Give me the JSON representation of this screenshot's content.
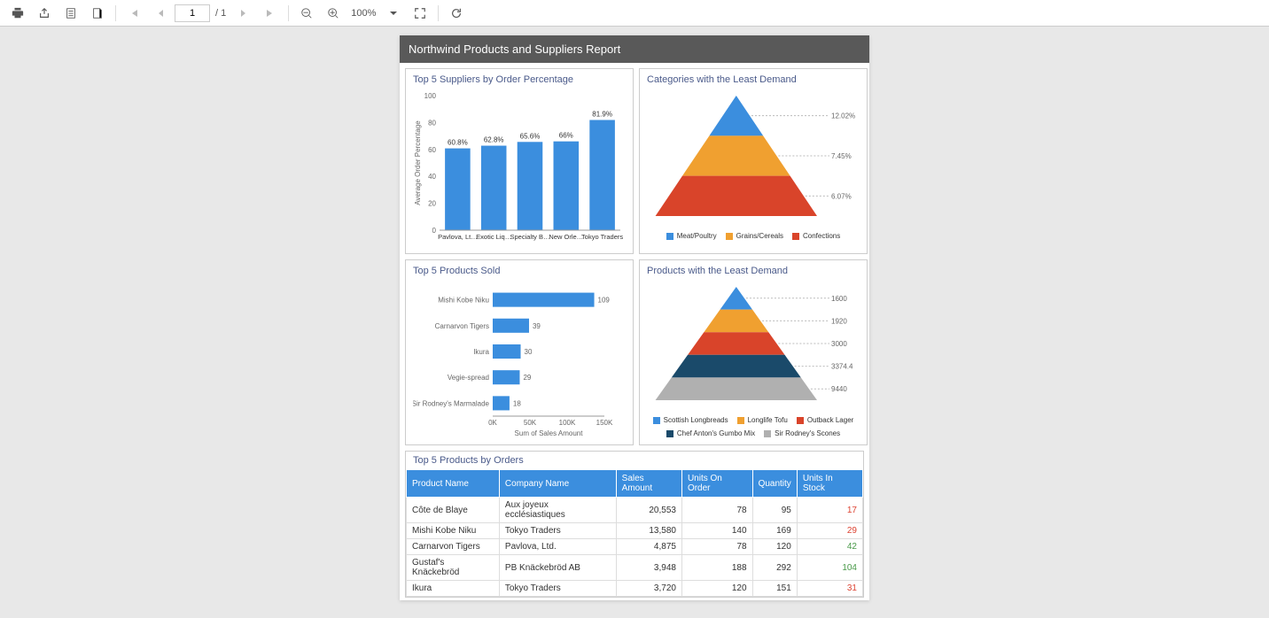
{
  "toolbar": {
    "page_current": "1",
    "page_total": "/ 1",
    "zoom": "100%"
  },
  "report": {
    "title": "Northwind Products and Suppliers Report"
  },
  "panels": {
    "suppliers": "Top 5 Suppliers by Order Percentage",
    "categories_low": "Categories with the Least Demand",
    "products_sold": "Top 5 Products Sold",
    "products_low": "Products with the Least Demand",
    "top_orders": "Top 5 Products by Orders"
  },
  "table": {
    "headers": [
      "Product Name",
      "Company Name",
      "Sales Amount",
      "Units On Order",
      "Quantity",
      "Units In Stock"
    ],
    "rows": [
      {
        "product": "Côte de Blaye",
        "company": "Aux joyeux ecclésiastiques",
        "sales": "20,553",
        "on_order": "78",
        "qty": "95",
        "stock": "17",
        "stock_class": "red"
      },
      {
        "product": "Mishi Kobe Niku",
        "company": "Tokyo Traders",
        "sales": "13,580",
        "on_order": "140",
        "qty": "169",
        "stock": "29",
        "stock_class": "red"
      },
      {
        "product": "Carnarvon Tigers",
        "company": "Pavlova, Ltd.",
        "sales": "4,875",
        "on_order": "78",
        "qty": "120",
        "stock": "42",
        "stock_class": "green"
      },
      {
        "product": "Gustaf's Knäckebröd",
        "company": "PB Knäckebröd AB",
        "sales": "3,948",
        "on_order": "188",
        "qty": "292",
        "stock": "104",
        "stock_class": "green"
      },
      {
        "product": "Ikura",
        "company": "Tokyo Traders",
        "sales": "3,720",
        "on_order": "120",
        "qty": "151",
        "stock": "31",
        "stock_class": "red"
      }
    ]
  },
  "chart_data": [
    {
      "id": "suppliers",
      "type": "bar",
      "orientation": "vertical",
      "title": "Top 5 Suppliers by Order Percentage",
      "ylabel": "Average Order Percentage",
      "ylim": [
        0,
        100
      ],
      "categories": [
        "Pavlova, Lt…",
        "Exotic Liq…",
        "Specialty B…",
        "New Orle…",
        "Tokyo Traders"
      ],
      "values": [
        60.8,
        62.8,
        65.6,
        66,
        81.9
      ],
      "value_labels": [
        "60.8%",
        "62.8%",
        "65.6%",
        "66%",
        "81.9%"
      ]
    },
    {
      "id": "categories_low",
      "type": "pyramid",
      "title": "Categories with the Least Demand",
      "series": [
        {
          "name": "Meat/Poultry",
          "value": 12.02,
          "label": "12.02%",
          "color": "#3b8ede"
        },
        {
          "name": "Grains/Cereals",
          "value": 7.45,
          "label": "7.45%",
          "color": "#f0a030"
        },
        {
          "name": "Confections",
          "value": 6.07,
          "label": "6.07%",
          "color": "#d9442a"
        }
      ]
    },
    {
      "id": "products_sold",
      "type": "bar",
      "orientation": "horizontal",
      "title": "Top 5 Products Sold",
      "xlabel": "Sum of Sales Amount",
      "xticks": [
        "0K",
        "50K",
        "100K",
        "150K"
      ],
      "categories": [
        "Mishi Kobe Niku",
        "Carnarvon Tigers",
        "Ikura",
        "Vegie-spread",
        "Sir Rodney's Marmalade"
      ],
      "values": [
        109,
        39,
        30,
        29,
        18
      ]
    },
    {
      "id": "products_low",
      "type": "pyramid",
      "title": "Products with the Least Demand",
      "series": [
        {
          "name": "Scottish Longbreads",
          "value": 1600,
          "label": "1600",
          "color": "#3b8ede"
        },
        {
          "name": "Longlife Tofu",
          "value": 1920,
          "label": "1920",
          "color": "#f0a030"
        },
        {
          "name": "Outback Lager",
          "value": 3000,
          "label": "3000",
          "color": "#d9442a"
        },
        {
          "name": "Chef Anton's Gumbo Mix",
          "value": 3374.4,
          "label": "3374.4",
          "color": "#1a4a6a"
        },
        {
          "name": "Sir Rodney's Scones",
          "value": 9440,
          "label": "9440",
          "color": "#b0b0b0"
        }
      ]
    }
  ]
}
